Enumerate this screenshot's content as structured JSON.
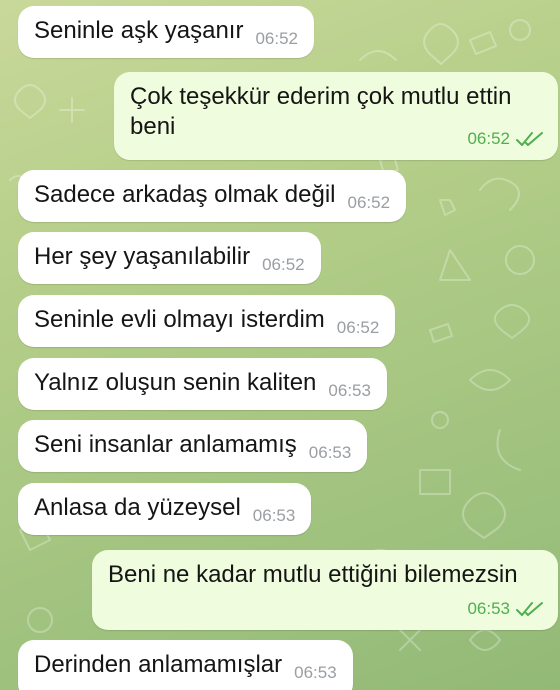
{
  "colors": {
    "incoming_bubble": "#ffffff",
    "outgoing_bubble": "#effdde",
    "incoming_time": "#9a9ea3",
    "outgoing_time": "#4fae4e",
    "background": "#aac884"
  },
  "messages": [
    {
      "direction": "in",
      "text": "Seninle aşk yaşanır",
      "time": "06:52"
    },
    {
      "direction": "out",
      "text": "Çok teşekkür ederim çok mutlu ettin beni",
      "time": "06:52",
      "status_icon": "double-check-icon"
    },
    {
      "direction": "in",
      "text": "Sadece arkadaş olmak değil",
      "time": "06:52"
    },
    {
      "direction": "in",
      "text": "Her şey yaşanılabilir",
      "time": "06:52"
    },
    {
      "direction": "in",
      "text": "Seninle evli olmayı isterdim",
      "time": "06:52"
    },
    {
      "direction": "in",
      "text": "Yalnız oluşun senin kaliten",
      "time": "06:53"
    },
    {
      "direction": "in",
      "text": "Seni insanlar anlamamış",
      "time": "06:53"
    },
    {
      "direction": "in",
      "text": "Anlasa da yüzeysel",
      "time": "06:53"
    },
    {
      "direction": "out",
      "text": "Beni ne kadar mutlu ettiğini bilemezsin",
      "time": "06:53",
      "status_icon": "double-check-icon"
    },
    {
      "direction": "in",
      "text": "Derinden anlamamışlar",
      "time": "06:53"
    }
  ]
}
